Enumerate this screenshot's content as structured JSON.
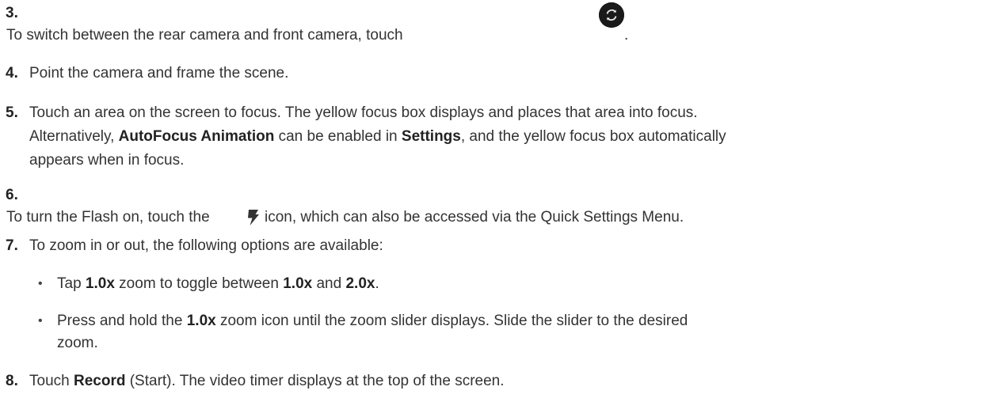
{
  "steps": [
    {
      "num": "3.",
      "text": "To switch between the rear camera and front camera, touch",
      "after_icon": "."
    },
    {
      "num": "4.",
      "text": "Point the camera and frame the scene."
    },
    {
      "num": "5.",
      "line1": "Touch an area on the screen to focus. The yellow focus box displays and places that area into focus.",
      "line2_a": "Alternatively, ",
      "line2_b": "AutoFocus Animation",
      "line2_c": " can be enabled in ",
      "line2_d": "Settings",
      "line2_e": ", and the yellow focus box automatically",
      "line3": "appears when in focus."
    },
    {
      "num": "6.",
      "text_a": "To turn the Flash on, touch the",
      "text_b": "icon, which can also be accessed via the Quick Settings Menu."
    },
    {
      "num": "7.",
      "text": "To zoom in or out, the following options are available:",
      "bullets": [
        {
          "a": "Tap ",
          "b": "1.0x",
          "c": " zoom to toggle between ",
          "d": "1.0x",
          "e": " and ",
          "f": "2.0x",
          "g": "."
        },
        {
          "a": "Press and hold the ",
          "b": "1.0x",
          "c": " zoom icon until the zoom slider displays. Slide the slider to the desired",
          "d": "zoom."
        }
      ]
    },
    {
      "num": "8.",
      "text_a": "Touch ",
      "text_b": "Record",
      "text_c": " (Start). The video timer displays at the top of the screen."
    }
  ],
  "icons": {
    "camera_switch": "camera-switch-icon",
    "flash": "flash-icon",
    "bullet_glyph": "•"
  }
}
